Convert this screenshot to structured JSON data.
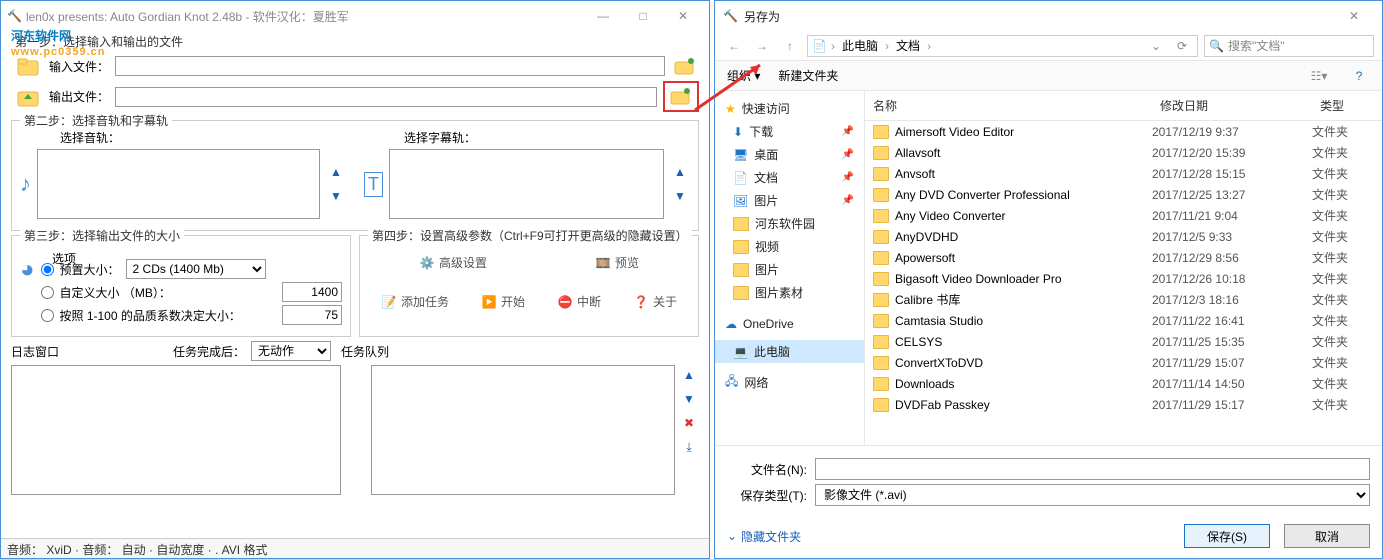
{
  "app": {
    "title": "len0x presents: Auto Gordian Knot 2.48b - 软件汉化：夏胜军",
    "watermark_line1": "河东软件网",
    "watermark_line2": "www.pc0359.cn",
    "step1": {
      "label": "第一步：选择输入和输出的文件",
      "input_label": "输入文件：",
      "output_label": "输出文件："
    },
    "step2": {
      "label": "第二步：选择音轨和字幕轨",
      "audio_label": "选择音轨：",
      "subtitle_label": "选择字幕轨："
    },
    "step3": {
      "label": "第三步：选择输出文件的大小",
      "options_title": "选项",
      "radio_preset": "预置大小：",
      "preset_value": "2 CDs (1400 Mb)",
      "radio_custom": "自定义大小 （MB）：",
      "custom_value": "1400",
      "radio_quality": "按照 1-100 的品质系数决定大小：",
      "quality_value": "75"
    },
    "step4": {
      "label": "第四步：设置高级参数（Ctrl+F9可打开更高级的隐藏设置）",
      "advanced": "高级设置",
      "preview": "预览",
      "add_task": "添加任务",
      "start": "开始",
      "abort": "中断",
      "about": "关于"
    },
    "task": {
      "after_label": "任务完成后：",
      "after_value": "无动作",
      "log_label": "日志窗口",
      "queue_label": "任务队列"
    },
    "status": "音频： XviD · 音频： 自动 · 自动宽度 · . AVI 格式"
  },
  "dialog": {
    "title": "另存为",
    "breadcrumb": {
      "root": "此电脑",
      "folder": "文档"
    },
    "search_placeholder": "搜索\"文档\"",
    "toolbar": {
      "organize": "组织 ▾",
      "newfolder": "新建文件夹"
    },
    "nav": {
      "quick": "快速访问",
      "downloads": "下载",
      "desktop": "桌面",
      "documents": "文档",
      "pictures": "图片",
      "hedong": "河东软件园",
      "video": "视频",
      "pictures2": "图片",
      "picmat": "图片素材",
      "onedrive": "OneDrive",
      "thispc": "此电脑",
      "network": "网络"
    },
    "headers": {
      "name": "名称",
      "date": "修改日期",
      "type": "类型"
    },
    "files": [
      {
        "name": "Aimersoft Video Editor",
        "date": "2017/12/19 9:37",
        "type": "文件夹"
      },
      {
        "name": "Allavsoft",
        "date": "2017/12/20 15:39",
        "type": "文件夹"
      },
      {
        "name": "Anvsoft",
        "date": "2017/12/28 15:15",
        "type": "文件夹"
      },
      {
        "name": "Any DVD Converter Professional",
        "date": "2017/12/25 13:27",
        "type": "文件夹"
      },
      {
        "name": "Any Video Converter",
        "date": "2017/11/21 9:04",
        "type": "文件夹"
      },
      {
        "name": "AnyDVDHD",
        "date": "2017/12/5 9:33",
        "type": "文件夹"
      },
      {
        "name": "Apowersoft",
        "date": "2017/12/29 8:56",
        "type": "文件夹"
      },
      {
        "name": "Bigasoft Video Downloader Pro",
        "date": "2017/12/26 10:18",
        "type": "文件夹"
      },
      {
        "name": "Calibre 书库",
        "date": "2017/12/3 18:16",
        "type": "文件夹"
      },
      {
        "name": "Camtasia Studio",
        "date": "2017/11/22 16:41",
        "type": "文件夹"
      },
      {
        "name": "CELSYS",
        "date": "2017/11/25 15:35",
        "type": "文件夹"
      },
      {
        "name": "ConvertXToDVD",
        "date": "2017/11/29 15:07",
        "type": "文件夹"
      },
      {
        "name": "Downloads",
        "date": "2017/11/14 14:50",
        "type": "文件夹"
      },
      {
        "name": "DVDFab Passkey",
        "date": "2017/11/29 15:17",
        "type": "文件夹"
      }
    ],
    "filename_label": "文件名(N):",
    "filetype_label": "保存类型(T):",
    "filetype_value": "影像文件 (*.avi)",
    "hide_folders": "隐藏文件夹",
    "save": "保存(S)",
    "cancel": "取消"
  }
}
